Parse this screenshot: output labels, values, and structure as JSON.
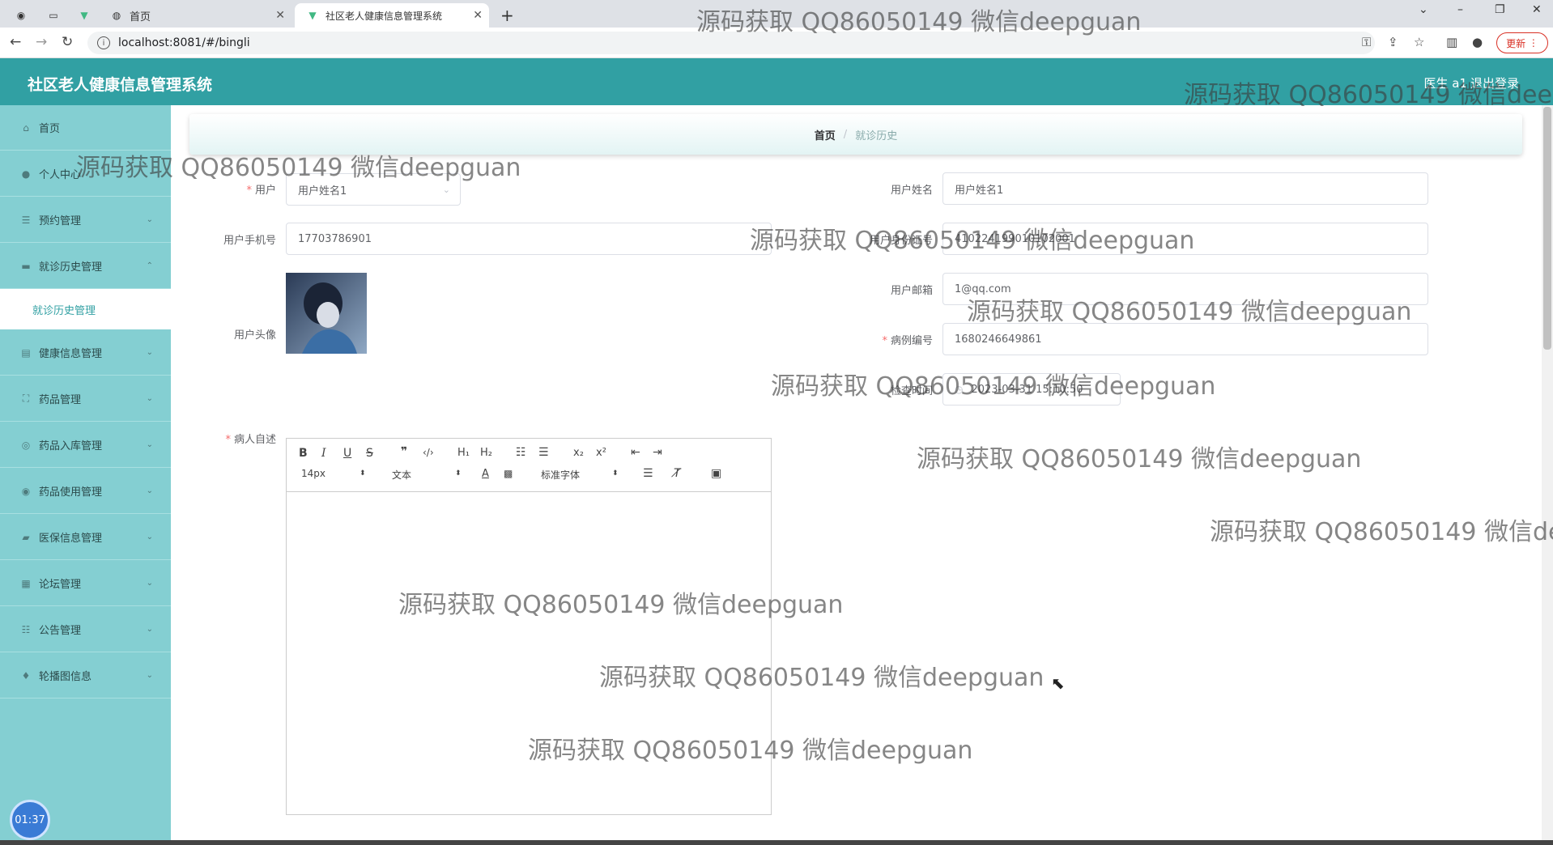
{
  "browser": {
    "tabs": [
      {
        "title": ""
      },
      {
        "title": ""
      },
      {
        "title": "首页"
      },
      {
        "title": "社区老人健康信息管理系统"
      }
    ],
    "url": "localhost:8081/#/bingli",
    "update_label": "更新"
  },
  "header": {
    "title": "社区老人健康信息管理系统",
    "user": "医生 a1",
    "logout": "退出登录"
  },
  "sidebar": {
    "items": [
      {
        "label": "首页",
        "icon": "home-icon"
      },
      {
        "label": "个人中心",
        "icon": "user-icon"
      },
      {
        "label": "预约管理",
        "icon": "list-icon"
      },
      {
        "label": "就诊历史管理",
        "icon": "record-icon"
      },
      {
        "label": "健康信息管理",
        "icon": "clipboard-icon"
      },
      {
        "label": "药品管理",
        "icon": "scan-icon"
      },
      {
        "label": "药品入库管理",
        "icon": "compass-icon"
      },
      {
        "label": "药品使用管理",
        "icon": "target-icon"
      },
      {
        "label": "医保信息管理",
        "icon": "chat-icon"
      },
      {
        "label": "论坛管理",
        "icon": "grid-icon"
      },
      {
        "label": "公告管理",
        "icon": "sliders-icon"
      },
      {
        "label": "轮播图信息",
        "icon": "mic-icon"
      }
    ],
    "submenu": {
      "label": "就诊历史管理"
    },
    "clock": "01:37"
  },
  "breadcrumb": {
    "home": "首页",
    "current": "就诊历史"
  },
  "form": {
    "user_label": "用户",
    "user_value": "用户姓名1",
    "user_name_label": "用户姓名",
    "user_name_value": "用户姓名1",
    "phone_label": "用户手机号",
    "phone_value": "17703786901",
    "idcard_label": "用户身份证号",
    "idcard_value": "410224199010102001",
    "avatar_label": "用户头像",
    "email_label": "用户邮箱",
    "email_value": "1@qq.com",
    "case_no_label": "病例编号",
    "case_no_value": "1680246649861",
    "check_time_label": "检查时间",
    "check_time_value": "2023-03-31 15:10:50",
    "self_report_label": "病人自述"
  },
  "editor": {
    "font_size": "14px",
    "block_type": "文本",
    "font_family": "标准字体"
  },
  "watermark": "源码获取 QQ86050149 微信deepguan"
}
